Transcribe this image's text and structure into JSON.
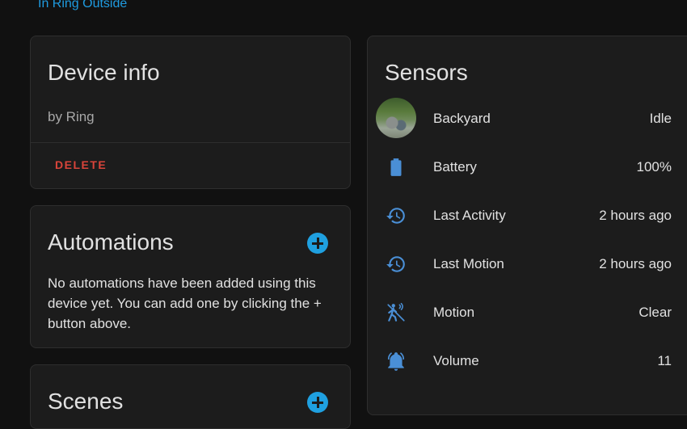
{
  "breadcrumb": {
    "area_link": "In Ring Outside"
  },
  "device_info": {
    "title": "Device info",
    "by": "by Ring",
    "delete_label": "DELETE"
  },
  "automations": {
    "title": "Automations",
    "description": "No automations have been added using this device yet. You can add one by clicking the + button above."
  },
  "scenes": {
    "title": "Scenes"
  },
  "sensors": {
    "title": "Sensors",
    "rows": [
      {
        "name": "Backyard",
        "value": "Idle",
        "icon": "camera-thumbnail"
      },
      {
        "name": "Battery",
        "value": "100%",
        "icon": "battery-icon"
      },
      {
        "name": "Last Activity",
        "value": "2 hours ago",
        "icon": "history-icon"
      },
      {
        "name": "Last Motion",
        "value": "2 hours ago",
        "icon": "history-icon"
      },
      {
        "name": "Motion",
        "value": "Clear",
        "icon": "walk-motion-icon"
      },
      {
        "name": "Volume",
        "value": "11",
        "icon": "bell-ring-icon"
      }
    ]
  },
  "colors": {
    "accent": "#1fa0e0",
    "delete": "#d9443a",
    "icon": "#4a8fd6",
    "background": "#111111",
    "card": "#1c1c1c"
  }
}
